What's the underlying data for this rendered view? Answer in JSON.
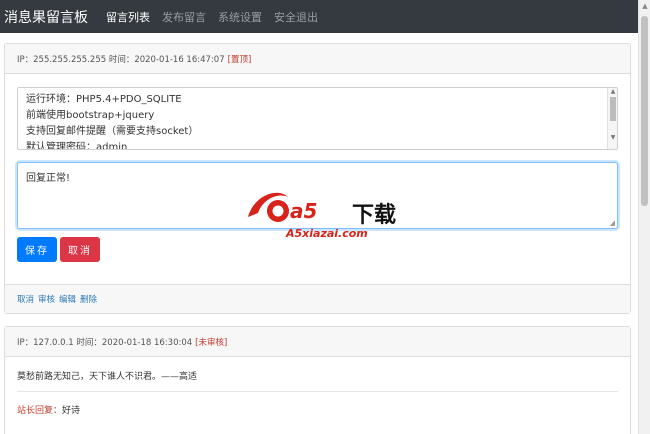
{
  "navbar": {
    "brand": "消息果留言板",
    "links": [
      {
        "label": "留言列表",
        "active": true
      },
      {
        "label": "发布留言",
        "active": false
      },
      {
        "label": "系统设置",
        "active": false
      },
      {
        "label": "安全退出",
        "active": false
      }
    ]
  },
  "messages": [
    {
      "header": "IP：255.255.255.255 时间：2020-01-16 16:47:07",
      "tag": "[置顶]",
      "content_lines": [
        "运行环境：PHP5.4+PDO_SQLITE",
        "前端使用bootstrap+jquery",
        "支持回复邮件提醒（需要支持socket）",
        "默认管理密码：admin"
      ],
      "reply_value": "回复正常!",
      "buttons": {
        "save": "保存",
        "cancel": "取消"
      },
      "actions": [
        "取消",
        "审核",
        "编辑",
        "删除"
      ]
    },
    {
      "header": "IP：127.0.0.1 时间：2020-01-18 16:30:04",
      "tag": "[未审核]",
      "content": "莫愁前路无知己，天下谁人不识君。——高适",
      "admin_reply_label": "站长回复：",
      "admin_reply_text": "好诗"
    }
  ],
  "watermark": {
    "logo_text": "a5",
    "title": "下载",
    "url": "A5xiazai.com"
  },
  "colors": {
    "navbar_bg": "#343a40",
    "primary": "#007bff",
    "danger": "#dc3545",
    "tag_red": "#c0392b",
    "link_blue": "#2a7ab8"
  }
}
